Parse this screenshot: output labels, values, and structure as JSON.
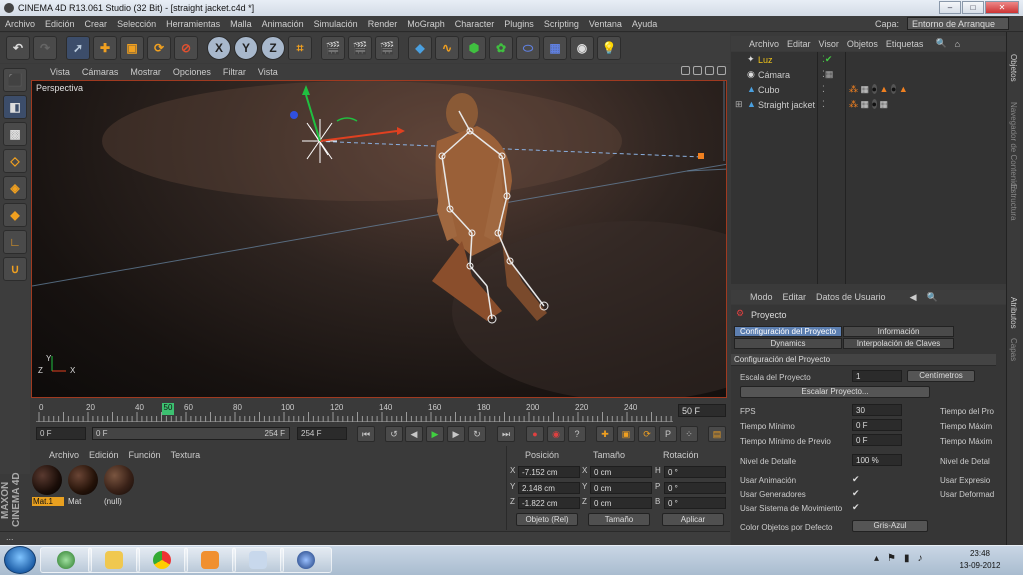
{
  "window": {
    "title": "CINEMA 4D R13.061 Studio (32 Bit) - [straight jacket.c4d *]",
    "min": "–",
    "max": "□",
    "close": "✕"
  },
  "menu": [
    "Archivo",
    "Edición",
    "Crear",
    "Selección",
    "Herramientas",
    "Malla",
    "Animación",
    "Simulación",
    "Render",
    "MoGraph",
    "Character",
    "Plugins",
    "Scripting",
    "Ventana",
    "Ayuda"
  ],
  "layer": {
    "label": "Capa:",
    "value": "Entorno de Arranque"
  },
  "viewport": {
    "menu": [
      "Vista",
      "Cámaras",
      "Mostrar",
      "Opciones",
      "Filtrar",
      "Vista"
    ],
    "name": "Perspectiva"
  },
  "timeline": {
    "ticks": [
      "0",
      "20",
      "40",
      "50",
      "60",
      "80",
      "100",
      "120",
      "140",
      "160",
      "180",
      "200",
      "220",
      "240"
    ],
    "current_frame": "50",
    "end_frame": "50 F"
  },
  "transport": {
    "start": "0 F",
    "range_start": "0 F",
    "range_end": "254 F",
    "end": "254 F"
  },
  "materials": {
    "menu": [
      "Archivo",
      "Edición",
      "Función",
      "Textura"
    ],
    "items": [
      {
        "name": "Mat.1"
      },
      {
        "name": "Mat"
      },
      {
        "name": "(null)"
      }
    ]
  },
  "coords": {
    "headers": [
      "Posición",
      "Tamaño",
      "Rotación"
    ],
    "rows": [
      {
        "axis": "X",
        "pos": "-7.152 cm",
        "size_axis": "X",
        "size": "0 cm",
        "rot_axis": "H",
        "rot": "0 °"
      },
      {
        "axis": "Y",
        "pos": "2.148 cm",
        "size_axis": "Y",
        "size": "0 cm",
        "rot_axis": "P",
        "rot": "0 °"
      },
      {
        "axis": "Z",
        "pos": "-1.822 cm",
        "size_axis": "Z",
        "size": "0 cm",
        "rot_axis": "B",
        "rot": "0 °"
      }
    ],
    "mode": "Objeto (Rel)",
    "size_mode": "Tamaño",
    "apply": "Aplicar"
  },
  "objects": {
    "menu": [
      "Archivo",
      "Editar",
      "Visor",
      "Objetos",
      "Etiquetas"
    ],
    "items": [
      {
        "name": "Luz",
        "color": "#f0c419"
      },
      {
        "name": "Cámara",
        "color": "#cccccc"
      },
      {
        "name": "Cubo",
        "color": "#cccccc"
      },
      {
        "name": "Straight jacket",
        "color": "#cccccc"
      }
    ]
  },
  "attributes": {
    "menu": [
      "Modo",
      "Editar",
      "Datos de Usuario"
    ],
    "title": "Proyecto",
    "tabs": [
      "Configuración del Proyecto",
      "Información",
      "Dynamics",
      "Interpolación de Claves"
    ],
    "section": "Configuración del Proyecto",
    "scale_label": "Escala del Proyecto",
    "scale_value": "1",
    "scale_unit": "Centímetros",
    "scale_button": "Escalar Proyecto...",
    "fps_label": "FPS",
    "fps_value": "30",
    "min_time_label": "Tiempo Mínimo",
    "min_time_value": "0 F",
    "min_preview_label": "Tiempo Mínimo de Previo",
    "min_preview_value": "0 F",
    "detail_label": "Nivel de Detalle",
    "detail_value": "100 %",
    "right_labels": [
      "Tiempo del Pro",
      "Tiempo Máxim",
      "Tiempo Máxim",
      "Nivel de Detal",
      "Usar Expresio",
      "Usar Deformad"
    ],
    "use_anim": "Usar Animación",
    "use_gen": "Usar Generadores",
    "use_motion": "Usar Sistema de Movimiento",
    "color_label": "Color Objetos por Defecto",
    "color_value": "Gris-Azul"
  },
  "right_tabs": [
    "Objetos",
    "Navegador de Contenido",
    "Estructura",
    "Atributos",
    "Capas"
  ],
  "status": "...",
  "clock": {
    "time": "23:48",
    "date": "13-09-2012"
  }
}
